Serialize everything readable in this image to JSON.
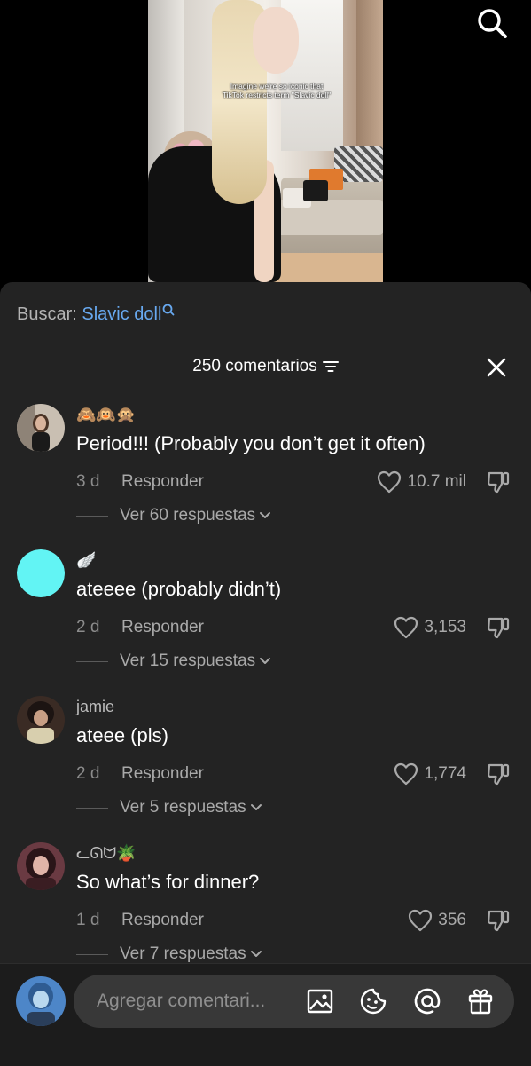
{
  "video": {
    "caption_line1": "Imagine we're so iconic that",
    "caption_line2": "TikTok restricts term \"Slavic doll\"",
    "search_icon": "search-icon"
  },
  "sheet": {
    "search_prefix": "Buscar: ",
    "search_term": "Slavic doll",
    "comment_count": "250 comentarios",
    "close_icon": "close-icon",
    "sort_icon": "sort-icon"
  },
  "comments": [
    {
      "user": "🙈🙉🙊",
      "text": "Period!!! (Probably you don’t get it often)",
      "time": "3 d",
      "reply_label": "Responder",
      "likes": "10.7 mil",
      "view_replies": "Ver 60 respuestas"
    },
    {
      "user": "🪽",
      "text": "ateeee (probably didn’t)",
      "time": "2 d",
      "reply_label": "Responder",
      "likes": "3,153",
      "view_replies": "Ver 15 respuestas",
      "avatar_color": "#62f4f4"
    },
    {
      "user": "jamie",
      "text": "ateee (pls)",
      "time": "2 d",
      "reply_label": "Responder",
      "likes": "1,774",
      "view_replies": "Ver 5 respuestas"
    },
    {
      "user": "ᓚᘏᗢ🪴",
      "text": "So what’s for dinner?",
      "time": "1 d",
      "reply_label": "Responder",
      "likes": "356",
      "view_replies": "Ver 7 respuestas"
    }
  ],
  "composer": {
    "placeholder": "Agregar comentari...",
    "icons": [
      "image-icon",
      "sticker-icon",
      "mention-icon",
      "gift-icon"
    ]
  },
  "colors": {
    "sheet_bg": "#232323",
    "search_term": "#68a9f0",
    "muted_text": "#a9a9a9"
  }
}
